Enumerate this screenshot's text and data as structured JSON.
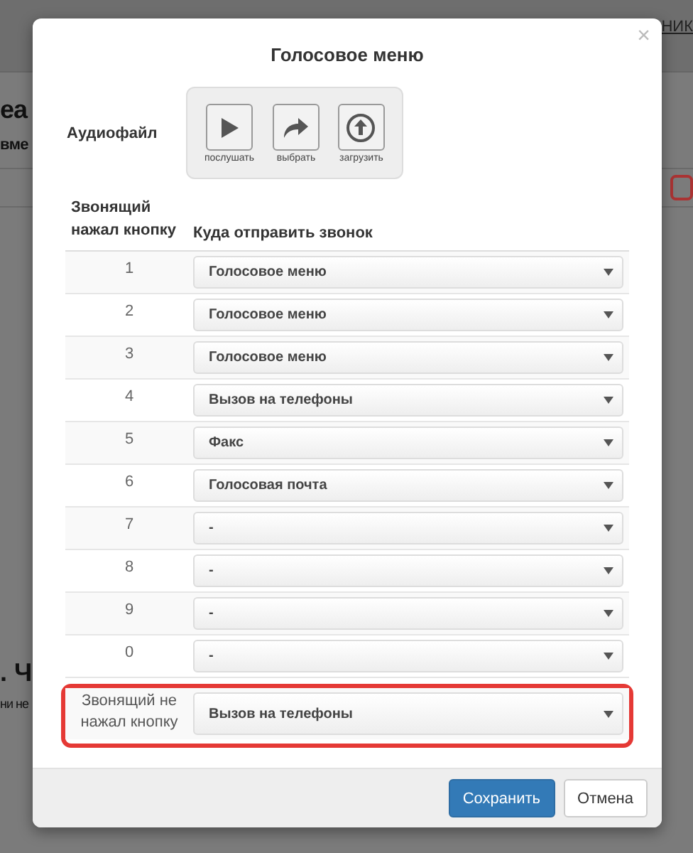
{
  "background": {
    "top_link": "НИК",
    "heading": "еа",
    "subheading": "вме",
    "section_heading": ". Ч",
    "section_text": "ни не"
  },
  "dialog": {
    "title": "Голосовое меню",
    "close": "×",
    "audio": {
      "label": "Аудиофайл",
      "actions": [
        {
          "kind": "play",
          "label": "послушать"
        },
        {
          "kind": "choose",
          "label": "выбрать"
        },
        {
          "kind": "upload",
          "label": "загрузить"
        }
      ]
    },
    "table": {
      "columns": [
        "Звонящий нажал кнопку",
        "Куда отправить звонок"
      ],
      "rows": [
        {
          "key": "1",
          "destination": "Голосовое меню",
          "highlighted": false
        },
        {
          "key": "2",
          "destination": "Голосовое меню",
          "highlighted": false
        },
        {
          "key": "3",
          "destination": "Голосовое меню",
          "highlighted": false
        },
        {
          "key": "4",
          "destination": "Вызов на телефоны",
          "highlighted": false
        },
        {
          "key": "5",
          "destination": "Факс",
          "highlighted": false
        },
        {
          "key": "6",
          "destination": "Голосовая почта",
          "highlighted": false
        },
        {
          "key": "7",
          "destination": "-",
          "highlighted": false
        },
        {
          "key": "8",
          "destination": "-",
          "highlighted": false
        },
        {
          "key": "9",
          "destination": "-",
          "highlighted": false
        },
        {
          "key": "0",
          "destination": "-",
          "highlighted": false
        },
        {
          "key": "Звонящий не нажал кнопку",
          "destination": "Вызов на телефоны",
          "highlighted": true
        }
      ]
    },
    "buttons": [
      {
        "kind": "primary",
        "label": "Сохранить"
      },
      {
        "kind": "default",
        "label": "Отмена"
      }
    ]
  }
}
